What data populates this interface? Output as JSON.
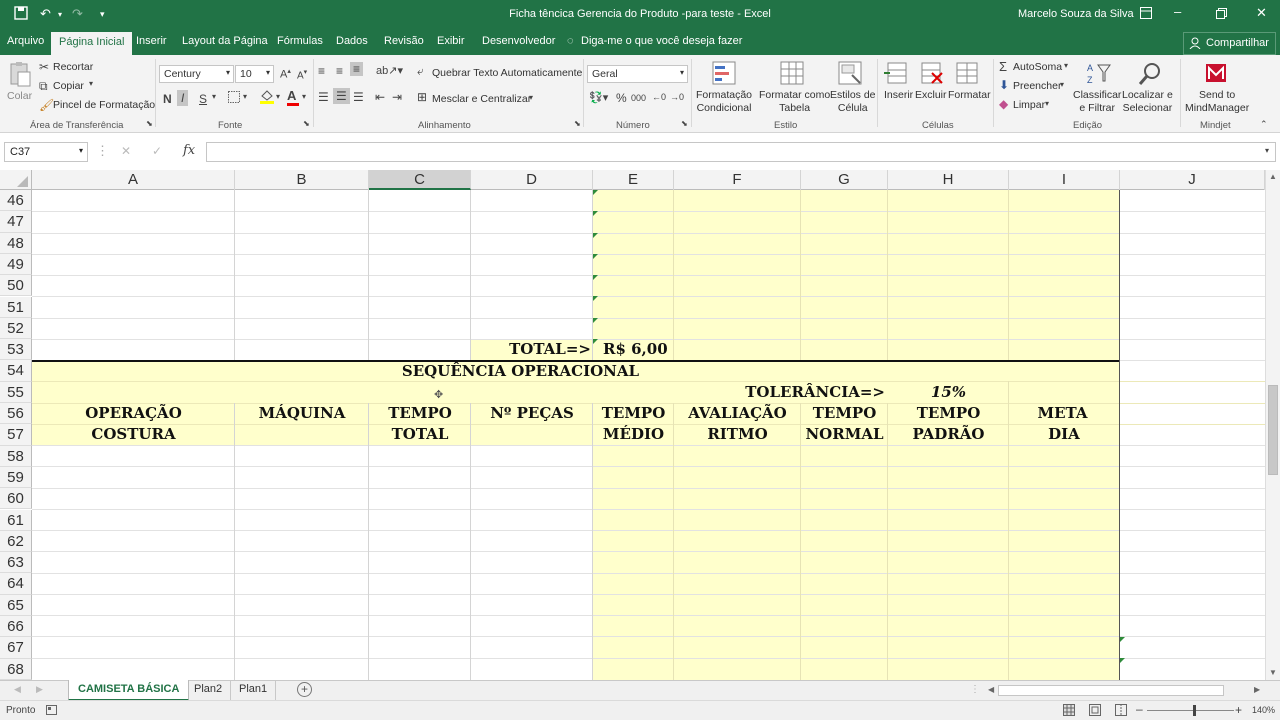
{
  "window": {
    "title": "Ficha têncica Gerencia do Produto -para teste  -  Excel",
    "user": "Marcelo Souza da Silva"
  },
  "menu_tabs": [
    "Arquivo",
    "Página Inicial",
    "Inserir",
    "Layout da Página",
    "Fórmulas",
    "Dados",
    "Revisão",
    "Exibir",
    "Desenvolvedor"
  ],
  "tell_me": "Diga-me o que você deseja fazer",
  "share": "Compartilhar",
  "ribbon": {
    "clipboard": {
      "paste": "Colar",
      "cut": "Recortar",
      "copy": "Copiar",
      "format_painter": "Pincel de Formatação",
      "label": "Área de Transferência"
    },
    "font": {
      "name": "Century",
      "size": "10",
      "bold": "N",
      "italic": "I",
      "underline": "S",
      "label": "Fonte"
    },
    "alignment": {
      "wrap": "Quebrar Texto Automaticamente",
      "merge": "Mesclar e Centralizar",
      "label": "Alinhamento"
    },
    "number": {
      "format": "Geral",
      "label": "Número"
    },
    "styles": {
      "cond": "Formatação\nCondicional",
      "table": "Formatar como\nTabela",
      "cell": "Estilos de\nCélula",
      "label": "Estilo"
    },
    "cells": {
      "insert": "Inserir",
      "delete": "Excluir",
      "format": "Formatar",
      "label": "Células"
    },
    "editing": {
      "autosum": "AutoSoma",
      "fill": "Preencher",
      "clear": "Limpar",
      "sort": "Classificar\ne Filtrar",
      "find": "Localizar e\nSelecionar",
      "label": "Edição"
    },
    "mindjet": {
      "send": "Send to\nMindManager",
      "label": "Mindjet"
    }
  },
  "namebox": "C37",
  "formula_glyphs": {
    "cancel": "✕",
    "enter": "✓",
    "fx": "fx"
  },
  "columns": [
    "A",
    "B",
    "C",
    "D",
    "E",
    "F",
    "G",
    "H",
    "I",
    "J"
  ],
  "rows": [
    "46",
    "47",
    "48",
    "49",
    "50",
    "51",
    "52",
    "53",
    "54",
    "55",
    "56",
    "57",
    "58",
    "59",
    "60",
    "61",
    "62",
    "63",
    "64",
    "65",
    "66",
    "67",
    "68"
  ],
  "cells": {
    "d53": "TOTAL=>",
    "e53": "R$  6,00",
    "title54": "SEQUÊNCIA OPERACIONAL",
    "g55": "TOLERÂNCIA=>",
    "h55": "15%",
    "a56": "OPERAÇÃO",
    "b56": "MÁQUINA",
    "c56": "TEMPO",
    "d56": "Nº PEÇAS",
    "e56": "TEMPO",
    "f56": "AVALIAÇÃO",
    "g56": "TEMPO",
    "h56": "TEMPO",
    "i56": "META",
    "a57": "COSTURA",
    "c57": "TOTAL",
    "e57": "MÉDIO",
    "f57": "RITMO",
    "g57": "NORMAL",
    "h57": "PADRÃO",
    "i57": "DIA"
  },
  "sheets": [
    "CAMISETA BÁSICA",
    "Plan2",
    "Plan1"
  ],
  "status": {
    "ready": "Pronto",
    "zoom": "140%"
  },
  "colors": {
    "excel_green": "#217346",
    "cell_yellow": "#ffffcc",
    "selected_col": "#d2d2d2"
  }
}
